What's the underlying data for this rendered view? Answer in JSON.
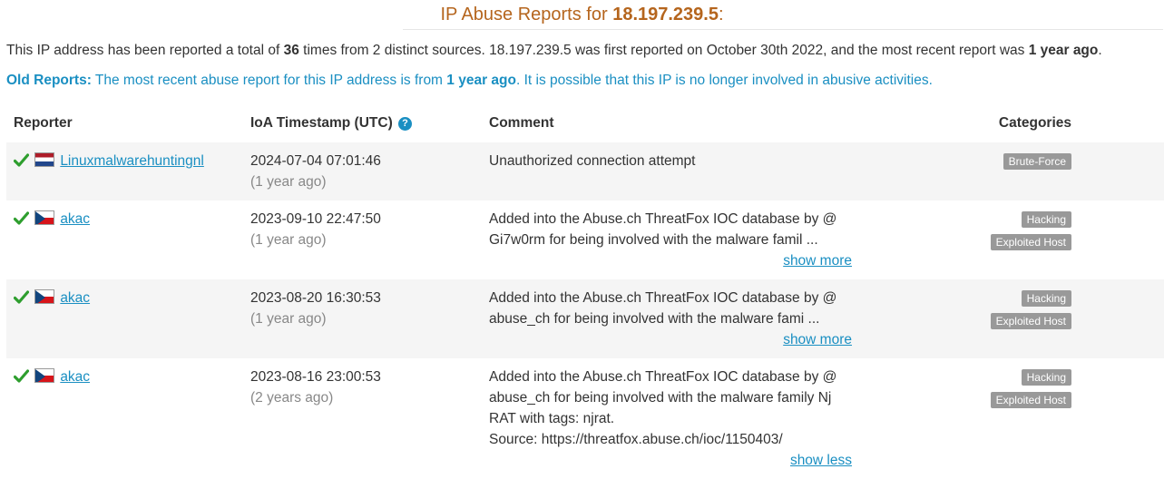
{
  "header": {
    "title_prefix": "IP Abuse Reports for",
    "ip": "18.197.239.5",
    "title_suffix": ":"
  },
  "summary": {
    "part1": "This IP address has been reported a total of ",
    "count": "36",
    "part2": " times from 2 distinct sources. 18.197.239.5 was first reported on October 30th 2022, and the most recent report was ",
    "recent": "1 year ago",
    "part3": "."
  },
  "old_reports": {
    "label": "Old Reports:",
    "part1": " The most recent abuse report for this IP address is from ",
    "recent": "1 year ago",
    "part2": ". It is possible that this IP is no longer involved in abusive activities."
  },
  "table": {
    "headers": {
      "reporter": "Reporter",
      "timestamp": "IoA Timestamp (UTC)",
      "comment": "Comment",
      "categories": "Categories"
    },
    "help_icon": "?",
    "rows": [
      {
        "reporter": "Linuxmalwarehuntingnl",
        "flag": "netherlands-flag",
        "timestamp": "2024-07-04 07:01:46",
        "ago": "(1 year ago)",
        "comment": "Unauthorized connection attempt",
        "toggle": "",
        "categories": [
          "Brute-Force"
        ]
      },
      {
        "reporter": "akac",
        "flag": "czech-flag",
        "timestamp": "2023-09-10 22:47:50",
        "ago": "(1 year ago)",
        "comment_lines": [
          "Added into the Abuse.ch ThreatFox IOC database by @",
          "Gi7w0rm for being involved with the malware famil ..."
        ],
        "toggle": "show more",
        "categories": [
          "Hacking",
          "Exploited Host"
        ]
      },
      {
        "reporter": "akac",
        "flag": "czech-flag",
        "timestamp": "2023-08-20 16:30:53",
        "ago": "(1 year ago)",
        "comment_lines": [
          "Added into the Abuse.ch ThreatFox IOC database by @",
          "abuse_ch for being involved with the malware fami ..."
        ],
        "toggle": "show more",
        "categories": [
          "Hacking",
          "Exploited Host"
        ]
      },
      {
        "reporter": "akac",
        "flag": "czech-flag",
        "timestamp": "2023-08-16 23:00:53",
        "ago": "(2 years ago)",
        "comment_lines": [
          "Added into the Abuse.ch ThreatFox IOC database by @",
          "abuse_ch for being involved with the malware family Nj",
          "RAT with tags: njrat.",
          "Source: https://threatfox.abuse.ch/ioc/1150403/"
        ],
        "toggle": "show less",
        "categories": [
          "Hacking",
          "Exploited Host"
        ]
      }
    ]
  },
  "colors": {
    "title": "#b5651d",
    "link": "#1a8fc2",
    "check": "#2e9e2e",
    "badge": "#999999"
  }
}
